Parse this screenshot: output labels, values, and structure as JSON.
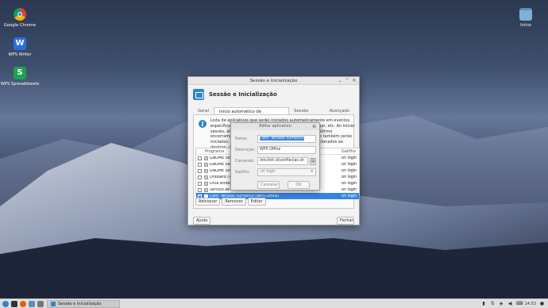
{
  "desktop": {
    "icons": [
      {
        "label": "Google Chrome"
      },
      {
        "label": "WPS Writer"
      },
      {
        "label": "WPS Spreadsheets"
      },
      {
        "label": "Início"
      }
    ]
  },
  "window": {
    "title": "Sessão e Inicialização",
    "header_title": "Sessão e Inicialização",
    "tabs": [
      {
        "label": "Geral"
      },
      {
        "label": "Início automático de aplicativos"
      },
      {
        "label": "Sessão atual"
      },
      {
        "label": "Avançado"
      }
    ],
    "info_text": "Lista de aplicativos que serão iniciados automaticamente em eventos específicos como iniciar sessão, encerrar sessão, desligar, etc. Ao iniciar sessão, além dos aplicativos que foram salvos em seu último encerramento de sessão, os aplicativos ativados abaixo também serão iniciados. Aplicativos ainda não listados podem ser adicionados ao desktop, mas você ainda...",
    "table": {
      "col_program": "Programa",
      "col_trigger": "Gatilho",
      "rows": [
        {
          "name": "GNOME Setti...",
          "trigger": "on login",
          "checked": false
        },
        {
          "name": "GNOME Setti...",
          "trigger": "on login",
          "checked": false
        },
        {
          "name": "GNOME Setti...",
          "trigger": "on login",
          "checked": false
        },
        {
          "name": "Onboard (Tec...",
          "trigger": "on login",
          "checked": false
        },
        {
          "name": "Orca screen r...",
          "trigger": "on login",
          "checked": false
        },
        {
          "name": "Serviço de at...                                         ...listen)",
          "trigger": "on login",
          "checked": false
        },
        {
          "name": "Conf. Teclado numérico (WPS Office)",
          "trigger": "on login",
          "checked": true
        }
      ]
    },
    "buttons": {
      "add": "Adicionar",
      "remove": "Remover",
      "edit": "Editar",
      "help": "Ajuda",
      "close": "Fechar"
    }
  },
  "dialog": {
    "title": "Editar aplicativo",
    "name_label": "Nome:",
    "name_value": "Conf. Teclado numérico",
    "desc_label": "Descrição:",
    "desc_value": "WPS Office",
    "cmd_label": "Comando:",
    "cmd_value": "/etc/init.d/confteclas.sh",
    "trigger_label": "Gatilho:",
    "trigger_value": "on login",
    "cancel": "Cancelar",
    "ok": "OK"
  },
  "taskbar": {
    "task_label": "Sessão e Inicialização",
    "clock": "14:53"
  },
  "colors": {
    "accent": "#3584e4",
    "app_icon": "#2f86c9"
  }
}
